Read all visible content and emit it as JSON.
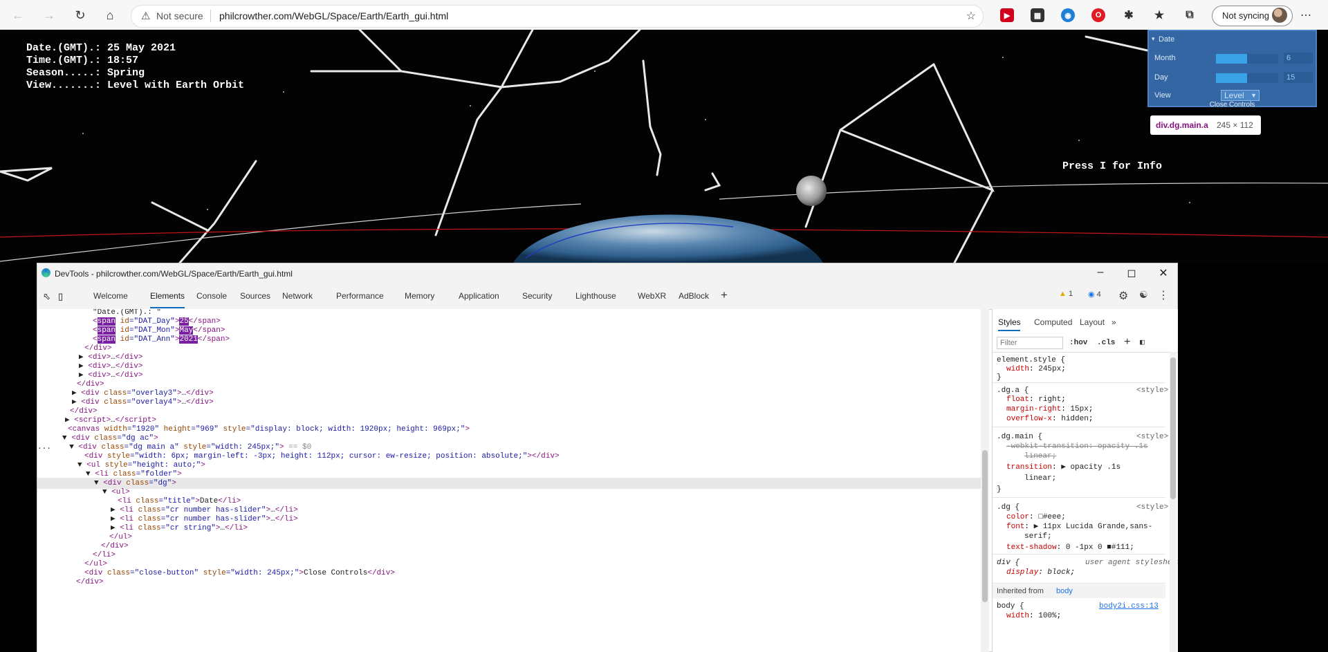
{
  "browser": {
    "not_secure": "Not secure",
    "url": "philcrowther.com/WebGL/Space/Earth/Earth_gui.html",
    "sync_label": "Not syncing"
  },
  "hud": {
    "date": "Date.(GMT).: 25 May 2021",
    "time": "Time.(GMT).: 18:57",
    "season": "Season.....: Spring",
    "view": "View.......: Level with Earth Orbit",
    "info": "Press I for Info"
  },
  "gui": {
    "folder_title": "Date",
    "month_label": "Month",
    "month_value": "6",
    "month_fill": 0.5,
    "day_label": "Day",
    "day_value": "15",
    "day_fill": 0.5,
    "view_label": "View",
    "view_value": "Level",
    "close": "Close Controls",
    "tooltip_name": "div.dg.main.a",
    "tooltip_size": "245 × 112"
  },
  "devtools": {
    "title": "DevTools - philcrowther.com/WebGL/Space/Earth/Earth_gui.html",
    "tabs": [
      "Welcome",
      "Elements",
      "Console",
      "Sources",
      "Network",
      "Performance",
      "Memory",
      "Application",
      "Security",
      "Lighthouse",
      "WebXR",
      "AdBlock"
    ],
    "warn_count": "1",
    "msg_count": "4",
    "styles_tabs": [
      "Styles",
      "Computed",
      "Layout"
    ],
    "filter_placeholder": "Filter",
    "hov": ":hov",
    "cls": ".cls",
    "inherited_label": "Inherited from",
    "inherited_from": "body"
  }
}
